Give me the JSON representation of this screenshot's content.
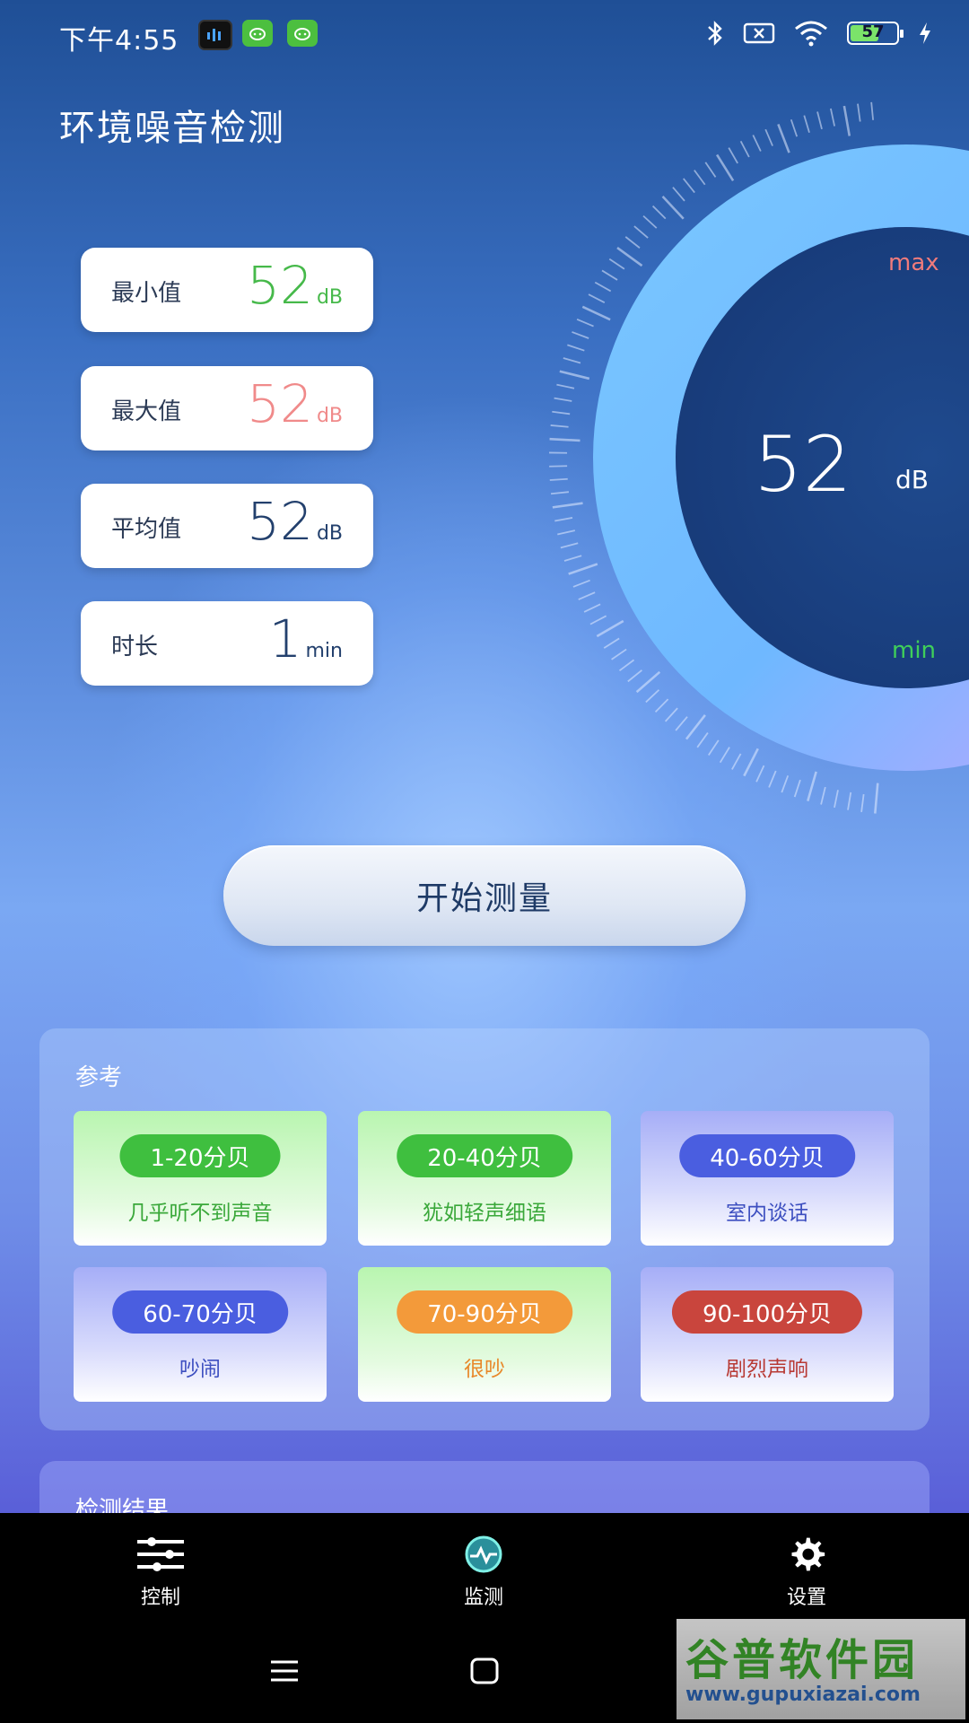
{
  "status_bar": {
    "time": "下午4:55",
    "battery": "57"
  },
  "app": {
    "title": "环境噪音检测"
  },
  "stats": [
    {
      "label": "最小值",
      "value": "52",
      "unit": "dB",
      "color": "#46b94a"
    },
    {
      "label": "最大值",
      "value": "52",
      "unit": "dB",
      "color": "#f08a8a"
    },
    {
      "label": "平均值",
      "value": "52",
      "unit": "dB",
      "color": "#23406d"
    },
    {
      "label": "时长",
      "value": "1",
      "unit": "min",
      "color": "#23406d"
    }
  ],
  "gauge": {
    "value": "52",
    "unit": "dB",
    "max_label": "max",
    "min_label": "min"
  },
  "start_button": {
    "label": "开始测量"
  },
  "reference": {
    "title": "参考",
    "items": [
      {
        "range": "1-20分贝",
        "desc": "几乎听不到声音",
        "pill_color": "#3fbf3f",
        "text_color": "#3aa83a",
        "style": "green"
      },
      {
        "range": "20-40分贝",
        "desc": "犹如轻声细语",
        "pill_color": "#3fbf3f",
        "text_color": "#3aa83a",
        "style": "green"
      },
      {
        "range": "40-60分贝",
        "desc": "室内谈话",
        "pill_color": "#4a5ee0",
        "text_color": "#3d4fc0",
        "style": "blue"
      },
      {
        "range": "60-70分贝",
        "desc": "吵闹",
        "pill_color": "#4a5ee0",
        "text_color": "#3d4fc0",
        "style": "blue"
      },
      {
        "range": "70-90分贝",
        "desc": "很吵",
        "pill_color": "#f39a3a",
        "text_color": "#e8882a",
        "style": "green"
      },
      {
        "range": "90-100分贝",
        "desc": "剧烈声响",
        "pill_color": "#c9453d",
        "text_color": "#b83a34",
        "style": "blue"
      }
    ]
  },
  "results": {
    "title": "检测结果"
  },
  "nav": [
    {
      "label": "控制",
      "icon": "sliders-icon"
    },
    {
      "label": "监测",
      "icon": "monitor-icon"
    },
    {
      "label": "设置",
      "icon": "gear-icon"
    }
  ],
  "watermark": {
    "line1": "谷普软件园",
    "line2": "www.gupuxiazai.com"
  }
}
